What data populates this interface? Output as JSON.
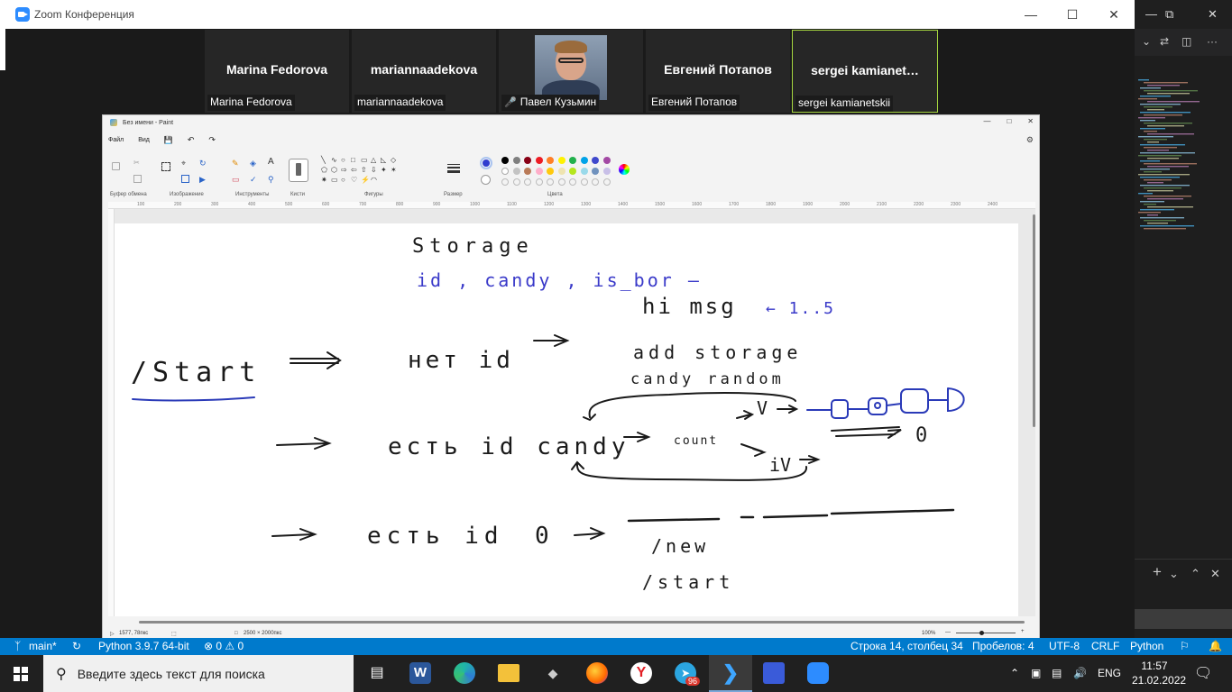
{
  "zoom": {
    "title": "Zoom Конференция",
    "participants": [
      {
        "big_name": "Marina Fedorova",
        "label": "Marina Fedorova"
      },
      {
        "big_name": "mariannaadekova",
        "label": "mariannaadekova"
      },
      {
        "big_name": "",
        "label": "Павел Кузьмин"
      },
      {
        "big_name": "Евгений Потапов",
        "label": "Евгений Потапов"
      },
      {
        "big_name": "sergei  kamianet…",
        "label": "sergei kamianetskii"
      }
    ]
  },
  "paint": {
    "title": "Без имени - Paint",
    "menu": {
      "file": "Файл",
      "view": "Вид"
    },
    "groups": {
      "clipboard": "Буфер обмена",
      "image": "Изображение",
      "tools": "Инструменты",
      "brushes": "Кисти",
      "shapes": "Фигуры",
      "size": "Размер",
      "colors": "Цвета"
    },
    "ruler_ticks": [
      "100",
      "200",
      "300",
      "400",
      "500",
      "600",
      "700",
      "800",
      "900",
      "1000",
      "1100",
      "1200",
      "1300",
      "1400",
      "1500",
      "1600",
      "1700",
      "1800",
      "1900",
      "2000",
      "2100",
      "2200",
      "2300",
      "2400"
    ],
    "status": {
      "cursor": "1577, 78пкс",
      "canvas_size": "2500 × 2000пкс",
      "zoom": "100%"
    },
    "colors": {
      "primary": "#2f3ccf",
      "palette_row1": [
        "#000000",
        "#7f7f7f",
        "#880015",
        "#ed1c24",
        "#ff7f27",
        "#fff200",
        "#22b14c",
        "#00a2e8",
        "#3f48cc",
        "#a349a4"
      ],
      "palette_row2": [
        "#ffffff",
        "#c3c3c3",
        "#b97a57",
        "#ffaec9",
        "#ffc90e",
        "#efe4b0",
        "#b5e61d",
        "#99d9ea",
        "#7092be",
        "#c8bfe7"
      ]
    },
    "drawing": {
      "storage": "Storage",
      "fields": "id , candy , is_bor —",
      "hi_msg": "hi msg",
      "range": "← 1..5",
      "start_cmd": "/Start",
      "no_id": "нет id",
      "add_storage": "add storage",
      "candy_random": "candy random",
      "has_id_candy": "есть id candy",
      "count": "count",
      "v": "V",
      "iv": "iV",
      "zero": "0",
      "has_id": "есть id",
      "zero2": "0",
      "new_cmd": "/new",
      "start_cmd2": "/start"
    }
  },
  "vscode": {
    "branch": "main*",
    "python": "Python 3.9.7 64-bit",
    "problems": "⊗ 0 ⚠ 0",
    "position": "Строка 14, столбец 34",
    "spaces": "Пробелов: 4",
    "encoding": "UTF-8",
    "eol": "CRLF",
    "language": "Python"
  },
  "taskbar": {
    "search_placeholder": "Введите здесь текст для поиска",
    "lang": "ENG",
    "time": "11:57",
    "date": "21.02.2022",
    "telegram_badge": "96"
  }
}
